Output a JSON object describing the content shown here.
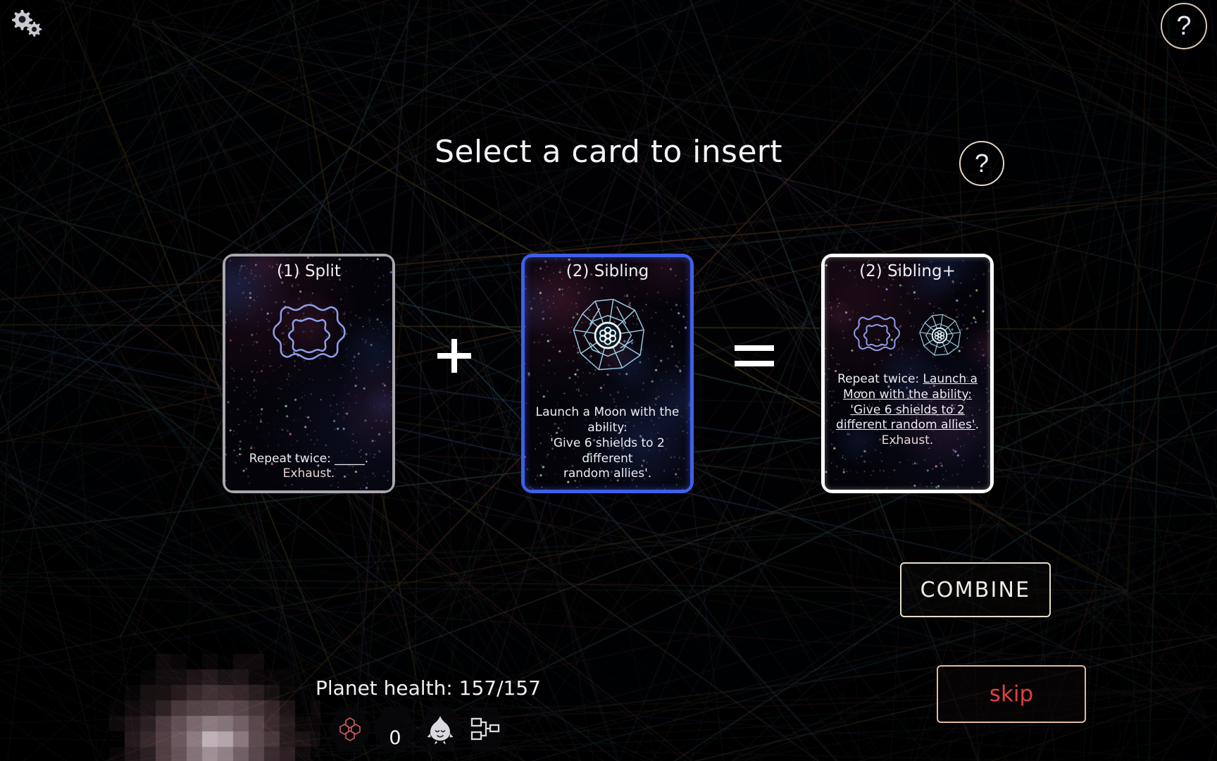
{
  "screen": {
    "title": "Select a card to insert",
    "background_color": "#05060c"
  },
  "topbar": {
    "settings_icon": "gears-icon",
    "help_icon": "question-mark-icon",
    "help_label": "?"
  },
  "title_help": {
    "icon": "question-mark-icon",
    "label": "?"
  },
  "operators": {
    "plus": "+",
    "equals": "="
  },
  "cards": [
    {
      "id": "card-1",
      "title": "(1) Split",
      "cost": 1,
      "name": "Split",
      "text_plain": "Repeat twice: _____.",
      "text_second": "Exhaust.",
      "art_icon": "split-sigil-icon",
      "art_color": "#8f9ee8",
      "state": "source",
      "selected": false,
      "border_color": "#a9a6ad"
    },
    {
      "id": "card-2",
      "title": "(2) Sibling",
      "cost": 2,
      "name": "Sibling",
      "text_line1": "Launch a Moon with the ability:",
      "text_line2": "'Give 6 shields to 2 different",
      "text_line3": "random allies'.",
      "art_icon": "moon-burst-sigil-icon",
      "art_color": "#9fd8ee",
      "state": "selected",
      "selected": true,
      "border_color": "#3f5fe8"
    },
    {
      "id": "card-3",
      "title": "(2) Sibling+",
      "cost": 2,
      "name": "Sibling+",
      "text_prefix": "Repeat twice: ",
      "text_underlined": "Launch a Moon with the ability: 'Give 6 shields to 2 different random allies'",
      "text_suffix": ".",
      "text_second": "Exhaust.",
      "art_icon_left": "split-sigil-icon",
      "art_icon_right": "moon-burst-sigil-icon",
      "state": "result",
      "selected": false,
      "border_color": "#ffffff"
    }
  ],
  "buttons": {
    "combine": "COMBINE",
    "skip": "skip",
    "combine_border": "#e8dccb",
    "skip_text_color": "#e0403f",
    "skip_border": "#e0bba0"
  },
  "hud": {
    "planet_health_label": "Planet health: 157/157",
    "planet_health_current": 157,
    "planet_health_max": 157,
    "resource_count": "0",
    "icons": [
      {
        "name": "hex-flower-icon",
        "color": "#c05a5a"
      },
      {
        "name": "hex-count-icon",
        "value": "0"
      },
      {
        "name": "creature-head-icon",
        "color": "#d8d8dc"
      },
      {
        "name": "node-tree-icon",
        "color": "#d8d8dc"
      }
    ],
    "planet_sprite": "pink-planet-sprite"
  }
}
